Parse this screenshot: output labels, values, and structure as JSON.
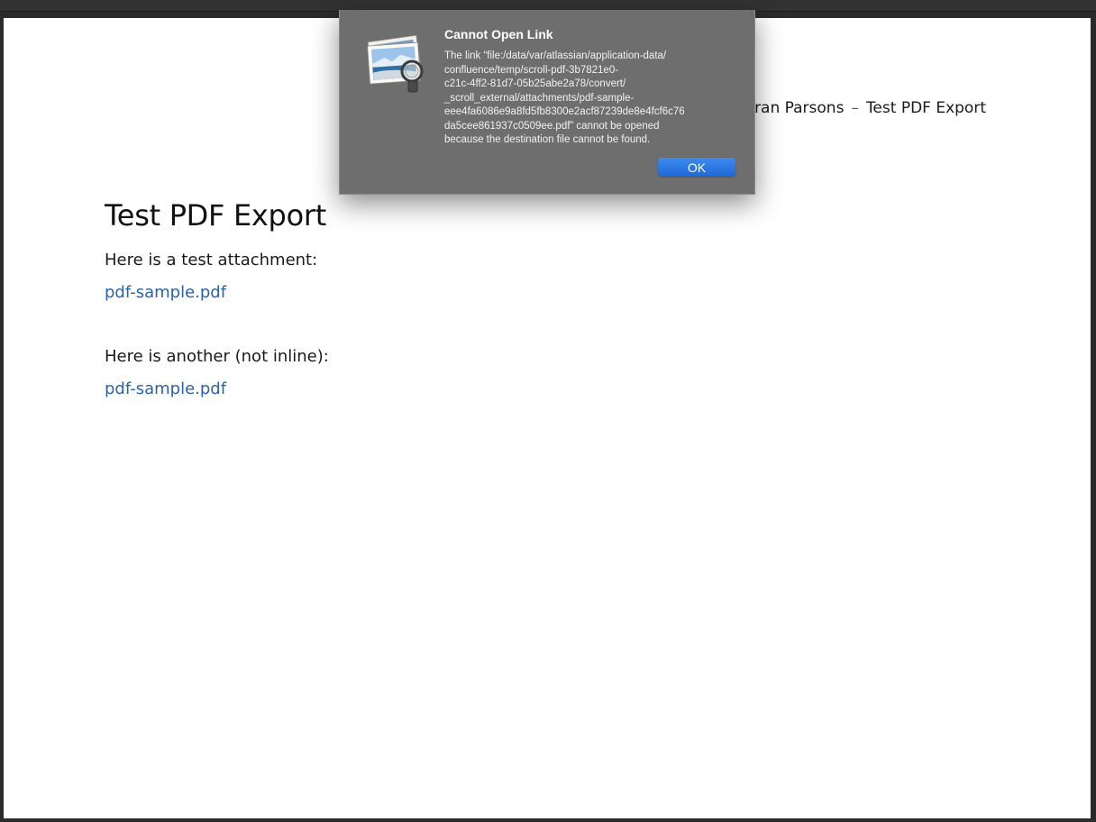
{
  "document": {
    "header": {
      "author": "eran Parsons",
      "separator": "–",
      "title": "Test PDF Export"
    },
    "title": "Test PDF Export",
    "paragraph_1": "Here is a test attachment:",
    "link_1": "pdf-sample.pdf",
    "paragraph_2": "Here is another (not inline):",
    "link_2": "pdf-sample.pdf"
  },
  "alert": {
    "icon": "preview-app-icon",
    "title": "Cannot Open Link",
    "message_lines": [
      "The link “file:/data/var/atlassian/application-data/",
      "confluence/temp/scroll-pdf-3b7821e0-",
      "c21c-4ff2-81d7-05b25abe2a78/convert/",
      "_scroll_external/attachments/pdf-sample-",
      "eee4fa6086e9a8fd5fb8300e2acf87239de8e4fcf6c76",
      "da5cee861937c0509ee.pdf” cannot be opened",
      "because the destination file cannot be found."
    ],
    "ok_label": "OK"
  },
  "colors": {
    "link": "#2a63a6",
    "alert_background": "#6e6e6e",
    "ok_button": "#1f68d8"
  }
}
